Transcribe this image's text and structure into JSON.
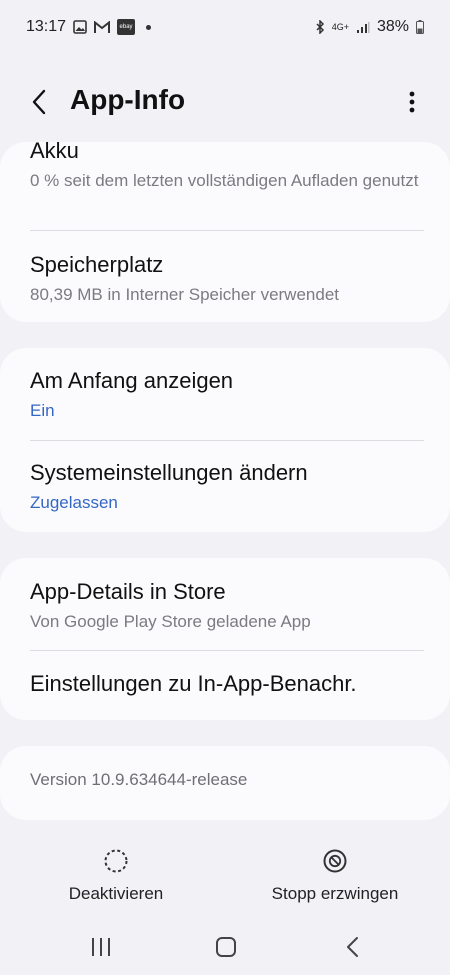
{
  "status_bar": {
    "time": "13:17",
    "ebay_label": "ebay",
    "network": "4G+",
    "battery": "38%"
  },
  "header": {
    "title": "App-Info"
  },
  "sections": {
    "akku": {
      "title": "Akku",
      "subtitle": "0 % seit dem letzten vollständigen Aufladen genutzt"
    },
    "storage": {
      "title": "Speicherplatz",
      "subtitle": "80,39 MB in Interner Speicher verwendet"
    },
    "show_on_top": {
      "title": "Am Anfang anzeigen",
      "value": "Ein"
    },
    "system_settings": {
      "title": "Systemeinstellungen ändern",
      "value": "Zugelassen"
    },
    "store_details": {
      "title": "App-Details in Store",
      "subtitle": "Von Google Play Store geladene App"
    },
    "in_app_notif": {
      "title": "Einstellungen zu In-App-Benachr."
    },
    "version": {
      "text": "Version 10.9.634644-release"
    }
  },
  "actions": {
    "deactivate_label": "Deaktivieren",
    "force_stop_label": "Stopp erzwingen"
  },
  "colors": {
    "accent": "#3467c4",
    "background": "#f2f2f6",
    "card": "#fbfbfd"
  }
}
